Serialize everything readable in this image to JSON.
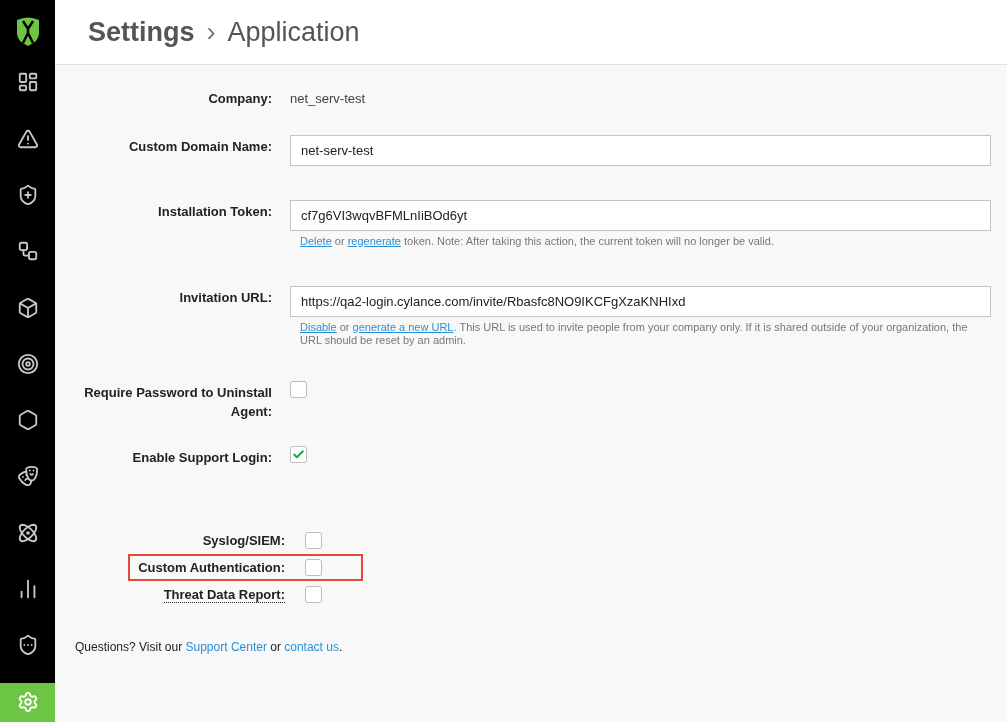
{
  "sidebar": {
    "items": [
      {
        "selected": false
      },
      {
        "selected": false
      },
      {
        "selected": false
      },
      {
        "selected": false
      },
      {
        "selected": false
      },
      {
        "selected": false
      },
      {
        "selected": false
      },
      {
        "selected": false
      },
      {
        "selected": false
      },
      {
        "selected": false
      },
      {
        "selected": false
      },
      {
        "selected": true
      }
    ]
  },
  "breadcrumb": {
    "parent": "Settings",
    "separator": "›",
    "current": "Application"
  },
  "fields": [
    {
      "kind": "text",
      "label": "Company:",
      "value": "net_serv-test"
    },
    {
      "kind": "input",
      "label": "Custom Domain Name:",
      "value": "net-serv-test"
    },
    {
      "kind": "input",
      "label": "Installation Token:",
      "value": "cf7g6VI3wqvBFMLnIiBOd6yt",
      "help": [
        {
          "kind": "link",
          "text": "Delete"
        },
        {
          "kind": "text",
          "text": " or "
        },
        {
          "kind": "link",
          "text": "regenerate"
        },
        {
          "kind": "text",
          "text": " token. Note: After taking this action, the current token will no longer be valid."
        }
      ]
    },
    {
      "kind": "input",
      "label": "Invitation URL:",
      "value": "https://qa2-login.cylance.com/invite/Rbasfc8NO9IKCFgXzaKNHIxd",
      "help": [
        {
          "kind": "link",
          "text": "Disable"
        },
        {
          "kind": "text",
          "text": " or "
        },
        {
          "kind": "link",
          "text": "generate a new URL"
        },
        {
          "kind": "text",
          "text": ". This URL is used to invite people from your company only. If it is shared outside of your organization, the URL should be reset by an admin."
        }
      ]
    },
    {
      "kind": "checkbox",
      "label": "Require Password to Uninstall Agent:",
      "checked": false
    },
    {
      "kind": "checkbox",
      "label": "Enable Support Login:",
      "checked": true
    }
  ],
  "integrations": [
    {
      "label": "Syslog/SIEM:",
      "checked": false,
      "highlighted": false,
      "has_tooltip": false
    },
    {
      "label": "Custom Authentication:",
      "checked": false,
      "highlighted": true,
      "has_tooltip": false
    },
    {
      "label": "Threat Data Report:",
      "checked": false,
      "highlighted": false,
      "has_tooltip": true
    }
  ],
  "footer": [
    {
      "kind": "text",
      "text": "Questions? Visit our "
    },
    {
      "kind": "link",
      "text": "Support Center"
    },
    {
      "kind": "text",
      "text": " or "
    },
    {
      "kind": "link",
      "text": "contact us"
    },
    {
      "kind": "text",
      "text": "."
    }
  ]
}
